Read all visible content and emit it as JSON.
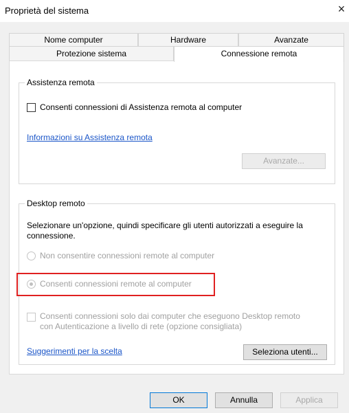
{
  "window": {
    "title": "Proprietà del sistema",
    "close_glyph": "×"
  },
  "tabs_back": [
    {
      "label": "Nome computer"
    },
    {
      "label": "Hardware"
    },
    {
      "label": "Avanzate"
    }
  ],
  "tabs_front": [
    {
      "label": "Protezione sistema"
    },
    {
      "label": "Connessione remota",
      "active": true
    }
  ],
  "assistenza": {
    "legend": "Assistenza remota",
    "checkbox_label": "Consenti connessioni di Assistenza remota al computer",
    "checkbox_checked": false,
    "info_link": "Informazioni su Assistenza remota",
    "advanced_button": "Avanzate..."
  },
  "desktop": {
    "legend": "Desktop remoto",
    "description": "Selezionare un'opzione, quindi specificare gli utenti autorizzati a eseguire la connessione.",
    "radio_no": "Non consentire connessioni remote al computer",
    "radio_yes": "Consenti connessioni remote al computer",
    "nla_label": "Consenti connessioni solo dai computer che eseguono Desktop remoto con Autenticazione a livello di rete (opzione consigliata)",
    "help_link": "Suggerimenti per la scelta",
    "select_users_button": "Seleziona utenti..."
  },
  "footer": {
    "ok": "OK",
    "cancel": "Annulla",
    "apply": "Applica"
  },
  "colors": {
    "highlight": "#e02020",
    "link": "#1a55c8"
  }
}
